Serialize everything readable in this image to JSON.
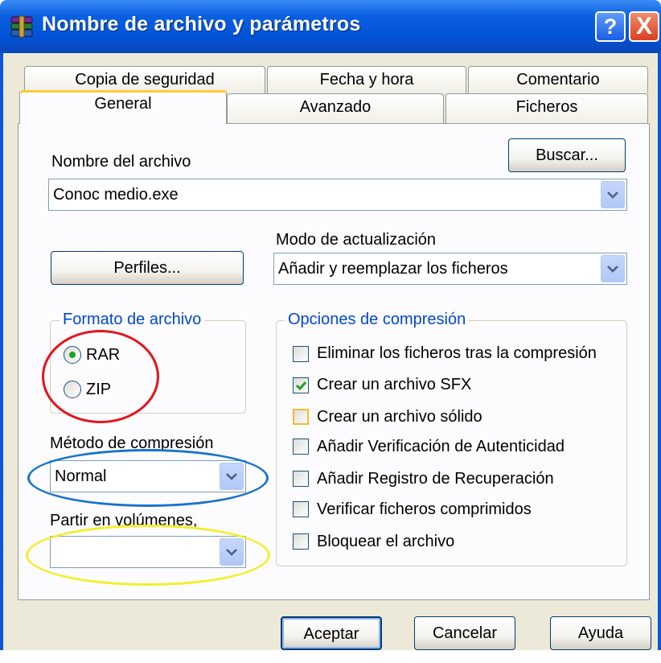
{
  "window": {
    "title": "Nombre de archivo y parámetros",
    "help_label": "?",
    "close_label": "X"
  },
  "tabs": {
    "row1": [
      "Copia de seguridad",
      "Fecha y hora",
      "Comentario"
    ],
    "row2": [
      "General",
      "Avanzado",
      "Ficheros"
    ],
    "active": "General"
  },
  "archive_name": {
    "label": "Nombre del archivo",
    "value": "Conoc medio.exe",
    "browse_label": "Buscar..."
  },
  "profiles_label": "Perfiles...",
  "update_mode": {
    "label": "Modo de actualización",
    "value": "Añadir y reemplazar los ficheros"
  },
  "archive_format": {
    "legend": "Formato de archivo",
    "options": [
      "RAR",
      "ZIP"
    ],
    "selected": "RAR"
  },
  "compression_method": {
    "label": "Método de compresión",
    "value": "Normal"
  },
  "split_volumes": {
    "label": "Partir en volúmenes,",
    "value": ""
  },
  "compression_options": {
    "legend": "Opciones de compresión",
    "items": [
      {
        "label": "Eliminar los ficheros tras la compresión",
        "checked": false
      },
      {
        "label": "Crear un archivo SFX",
        "checked": true
      },
      {
        "label": "Crear un archivo sólido",
        "checked": false
      },
      {
        "label": "Añadir Verificación de Autenticidad",
        "checked": false
      },
      {
        "label": "Añadir Registro de Recuperación",
        "checked": false
      },
      {
        "label": "Verificar ficheros comprimidos",
        "checked": false
      },
      {
        "label": "Bloquear el archivo",
        "checked": false
      }
    ]
  },
  "footer": {
    "ok_label": "Aceptar",
    "cancel_label": "Cancelar",
    "help_label": "Ayuda"
  },
  "annotation_colors": {
    "format": "#e3141c",
    "method": "#1a73c9",
    "volumes": "#f5ee2a"
  }
}
